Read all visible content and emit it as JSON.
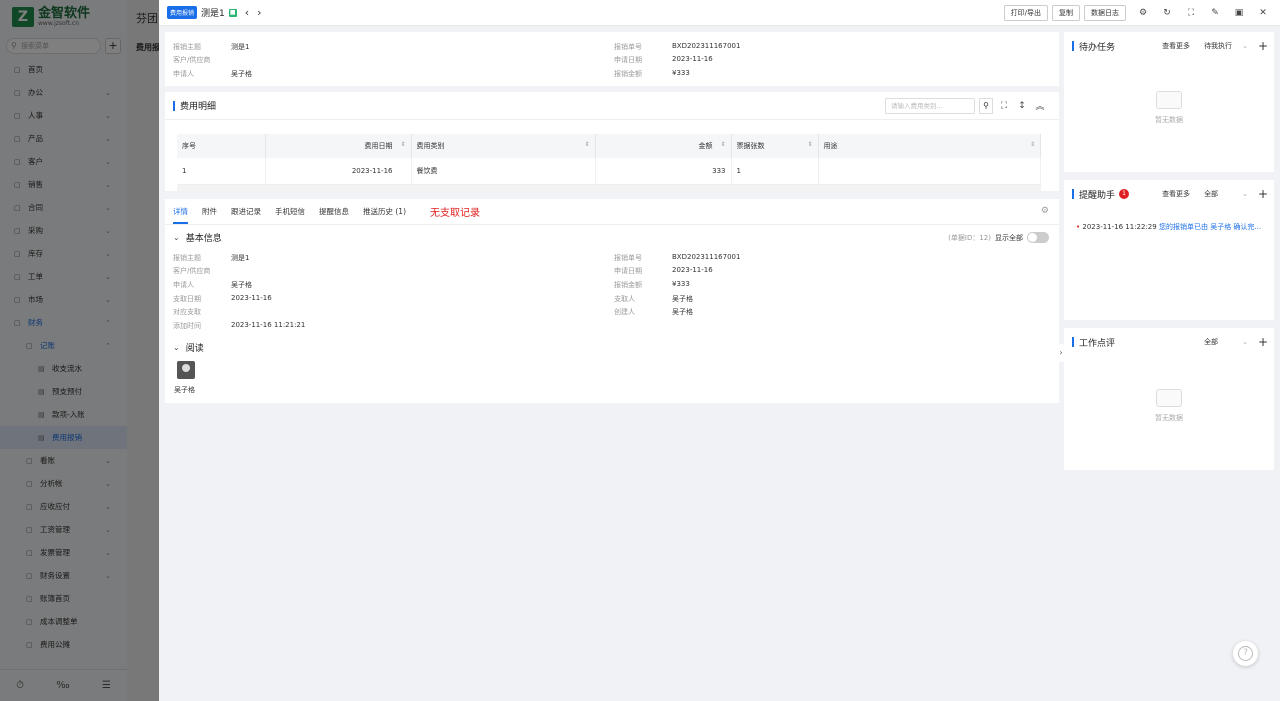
{
  "app": {
    "logo_text": "金智软件",
    "logo_sub": "www.jzsoft.cn",
    "bg_title": "芬团",
    "bg_tab": "费用报"
  },
  "sidebar": {
    "search_placeholder": "搜索菜单",
    "items": [
      {
        "label": "首页",
        "icon": "home-icon",
        "level": 0
      },
      {
        "label": "办公",
        "icon": "office-icon",
        "level": 0,
        "chev": "⌄"
      },
      {
        "label": "人事",
        "icon": "people-icon",
        "level": 0,
        "chev": "⌄"
      },
      {
        "label": "产品",
        "icon": "product-icon",
        "level": 0,
        "chev": "⌄"
      },
      {
        "label": "客户",
        "icon": "customer-icon",
        "level": 0,
        "chev": "⌄"
      },
      {
        "label": "销售",
        "icon": "sales-icon",
        "level": 0,
        "chev": "⌄"
      },
      {
        "label": "合同",
        "icon": "contract-icon",
        "level": 0,
        "chev": "⌄"
      },
      {
        "label": "采购",
        "icon": "purchase-icon",
        "level": 0,
        "chev": "⌄"
      },
      {
        "label": "库存",
        "icon": "inventory-icon",
        "level": 0,
        "chev": "⌄"
      },
      {
        "label": "工单",
        "icon": "ticket-icon",
        "level": 0,
        "chev": "⌄"
      },
      {
        "label": "市场",
        "icon": "market-icon",
        "level": 0,
        "chev": "⌄"
      },
      {
        "label": "财务",
        "icon": "finance-icon",
        "level": 0,
        "chev": "⌃",
        "active": true
      },
      {
        "label": "记账",
        "icon": "ledger-icon",
        "level": 1,
        "chev": "⌃",
        "active": true
      },
      {
        "label": "收支流水",
        "icon": "flow-icon",
        "level": 2
      },
      {
        "label": "预支预付",
        "icon": "advance-icon",
        "level": 2
      },
      {
        "label": "款项-入账",
        "icon": "receipt-icon",
        "level": 2
      },
      {
        "label": "费用报销",
        "icon": "expense-icon",
        "level": 2,
        "selected": true
      },
      {
        "label": "看账",
        "icon": "view-ledger-icon",
        "level": 1,
        "chev": "⌄"
      },
      {
        "label": "分析帐",
        "icon": "analysis-icon",
        "level": 1,
        "chev": "⌄"
      },
      {
        "label": "应收应付",
        "icon": "receivable-icon",
        "level": 1,
        "chev": "⌄"
      },
      {
        "label": "工资管理",
        "icon": "salary-icon",
        "level": 1,
        "chev": "⌄"
      },
      {
        "label": "发票管理",
        "icon": "invoice-icon",
        "level": 1,
        "chev": "⌄"
      },
      {
        "label": "财务设置",
        "icon": "finance-settings-icon",
        "level": 1,
        "chev": "⌄"
      },
      {
        "label": "账簿首页",
        "icon": "book-icon",
        "level": 1
      },
      {
        "label": "成本调整单",
        "icon": "cost-icon",
        "level": 1
      },
      {
        "label": "费用公摊",
        "icon": "share-icon",
        "level": 1
      }
    ],
    "footer": [
      "⏱",
      "‰",
      "☰"
    ]
  },
  "drawer": {
    "tag": "费用报销",
    "title": "测是1",
    "prev": "‹",
    "next": "›",
    "buttons": {
      "print": "打印/导出",
      "copy": "复制",
      "log": "数据日志"
    },
    "icons": {
      "settings": "⚙",
      "refresh": "↻",
      "fullscreen": "⛶",
      "edit": "✎",
      "save": "▣",
      "close": "✕"
    }
  },
  "summary": {
    "left": [
      {
        "k": "报销主题",
        "v": "测是1"
      },
      {
        "k": "客户/供应商",
        "v": ""
      },
      {
        "k": "申请人",
        "v": "吴子格"
      }
    ],
    "right": [
      {
        "k": "报销单号",
        "v": "BXD202311167001"
      },
      {
        "k": "申请日期",
        "v": "2023-11-16"
      },
      {
        "k": "报销金额",
        "v": "¥333"
      }
    ]
  },
  "expense": {
    "title": "费用明细",
    "search_placeholder": "请输入费用类别...",
    "columns": [
      "序号",
      "费用日期",
      "费用类别",
      "金额",
      "票据张数",
      "用途"
    ],
    "rows": [
      [
        "1",
        "2023-11-16",
        "餐饮费",
        "333",
        "1",
        ""
      ]
    ]
  },
  "tabs": {
    "items": [
      "详情",
      "附件",
      "跟进记录",
      "手机短信",
      "提醒信息",
      "推送历史 (1)"
    ],
    "note": "无支取记录"
  },
  "basic": {
    "title": "基本信息",
    "doc_id": "(单据ID：12)",
    "show_all": "显示全部",
    "left": [
      {
        "k": "报销主题",
        "v": "测是1"
      },
      {
        "k": "客户/供应商",
        "v": ""
      },
      {
        "k": "申请人",
        "v": "吴子格"
      },
      {
        "k": "支取日期",
        "v": "2023-11-16"
      },
      {
        "k": "对应支取",
        "v": ""
      },
      {
        "k": "添加时间",
        "v": "2023-11-16 11:21:21"
      }
    ],
    "right": [
      {
        "k": "报销单号",
        "v": "BXD202311167001"
      },
      {
        "k": "申请日期",
        "v": "2023-11-16"
      },
      {
        "k": "报销金额",
        "v": "¥333"
      },
      {
        "k": "支取人",
        "v": "吴子格"
      },
      {
        "k": "创建人",
        "v": "吴子格"
      }
    ]
  },
  "read": {
    "title": "阅读",
    "reader": "吴子格"
  },
  "panels": {
    "todo": {
      "title": "待办任务",
      "more": "查看更多",
      "filter": "待我执行",
      "empty": "暂无数据"
    },
    "remind": {
      "title": "提醒助手",
      "badge": "1",
      "more": "查看更多",
      "filter": "全部",
      "time": "2023-11-16 11:22:29",
      "text": "您的报销单已由 吴子格 确认完..."
    },
    "review": {
      "title": "工作点评",
      "filter": "全部",
      "empty": "暂无数据"
    }
  },
  "colors": {
    "accent": "#1a6ee8",
    "danger": "#e02020",
    "brand": "#1f8f4e"
  }
}
